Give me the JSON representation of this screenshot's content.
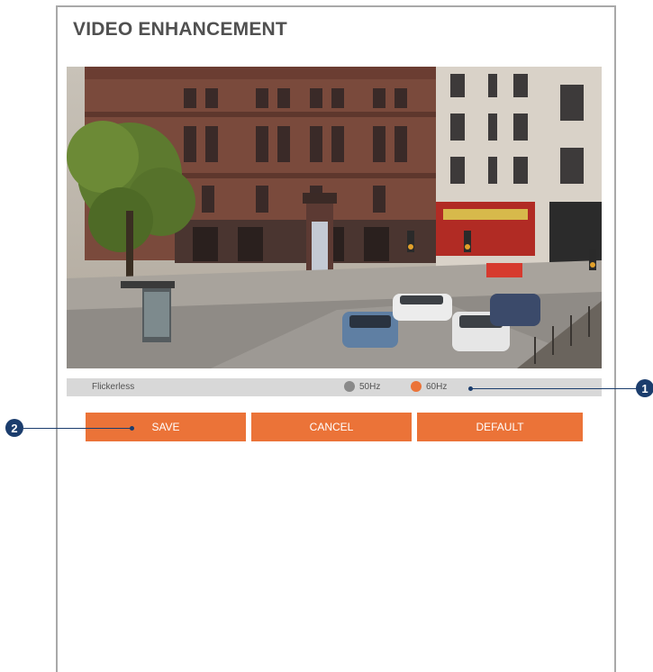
{
  "page": {
    "title": "VIDEO ENHANCEMENT"
  },
  "preview": {
    "alt": "Live camera preview"
  },
  "flickerless": {
    "label": "Flickerless",
    "options": [
      {
        "label": "50Hz",
        "color": "#8a8a8a"
      },
      {
        "label": "60Hz",
        "color": "#eb7338"
      }
    ],
    "selected": "60Hz"
  },
  "buttons": {
    "save": "SAVE",
    "cancel": "CANCEL",
    "default": "DEFAULT"
  },
  "callouts": {
    "one": "1",
    "two": "2"
  },
  "colors": {
    "accent": "#eb7338",
    "callout": "#1b3d6d",
    "row_bg": "#d8d8d8"
  }
}
